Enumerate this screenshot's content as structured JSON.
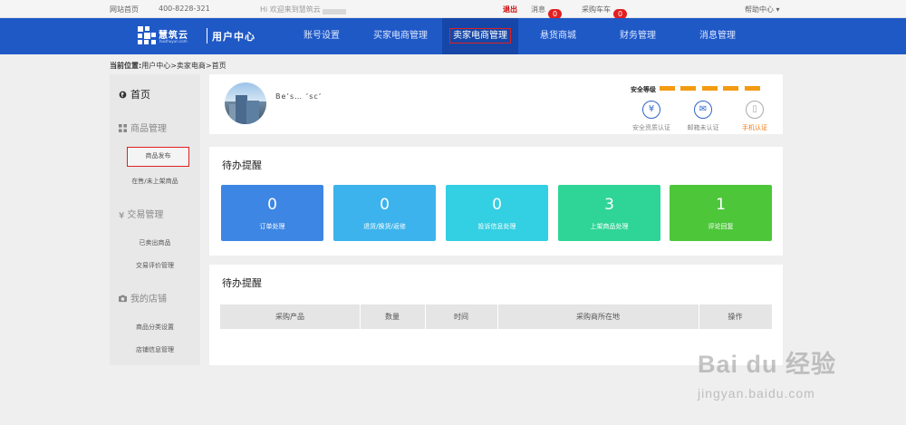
{
  "topbar": {
    "home_link": "网站首页",
    "phone": "400-8228-321",
    "welcome": "Hi 欢迎来到慧筑云",
    "site_name": "慧筑云",
    "logout": "退出",
    "messages_label": "消息",
    "messages_count": "0",
    "cart_label": "采购车车",
    "cart_count": "0",
    "help": "帮助中心"
  },
  "nav": {
    "logo_text": "慧筑云",
    "logo_sub": "huizhuyun.com",
    "title": "用户中心",
    "items": [
      {
        "label": "账号设置"
      },
      {
        "label": "买家电商管理"
      },
      {
        "label": "卖家电商管理"
      },
      {
        "label": "悬货商城"
      },
      {
        "label": "财务管理"
      },
      {
        "label": "消息管理"
      }
    ],
    "active_index": 2
  },
  "breadcrumb": {
    "prefix": "当前位置:",
    "path": "用户中心>卖家电商>首页"
  },
  "sidebar": {
    "home": "首页",
    "sections": [
      {
        "title": "商品管理",
        "icon": "grid-icon",
        "links": [
          "商品发布",
          "在售/未上架商品"
        ]
      },
      {
        "title": "交易管理",
        "icon": "yen-icon",
        "links": [
          "已卖出商品",
          "交易评价管理"
        ]
      },
      {
        "title": "我的店铺",
        "icon": "camera-icon",
        "links": [
          "商品分类设置",
          "店铺信息管理"
        ]
      }
    ]
  },
  "profile": {
    "username": "Be’s… ’sc’ ",
    "security_label": "安全等级",
    "security_level": 5,
    "security_max": 5,
    "certs": [
      {
        "label": "安全资质认证",
        "icon": "certificate-icon",
        "state": "done"
      },
      {
        "label": "邮箱未认证",
        "icon": "email-icon",
        "state": "pending"
      },
      {
        "label": "手机认证",
        "icon": "phone-icon",
        "state": "highlight"
      }
    ]
  },
  "todo": {
    "title": "待办提醒",
    "stats": [
      {
        "value": "0",
        "label": "订单处理",
        "color": "#3d86e3"
      },
      {
        "value": "0",
        "label": "退货/换货/返修",
        "color": "#3cb3ec"
      },
      {
        "value": "0",
        "label": "投诉信息处理",
        "color": "#33cfe2"
      },
      {
        "value": "3",
        "label": "上架商品处理",
        "color": "#2fd597"
      },
      {
        "value": "1",
        "label": "评论回复",
        "color": "#4dc63a"
      }
    ]
  },
  "purchase": {
    "title": "待办提醒",
    "columns": [
      "采购产品",
      "数量",
      "时间",
      "采购商所在地",
      "操作"
    ],
    "rows": []
  },
  "watermark": {
    "brand": "Bai du 经验",
    "url": "jingyan.baidu.com"
  },
  "colors": {
    "nav_bg": "#1f59c6",
    "security_bar": "#f39b11",
    "highlight_red": "#e02020"
  }
}
